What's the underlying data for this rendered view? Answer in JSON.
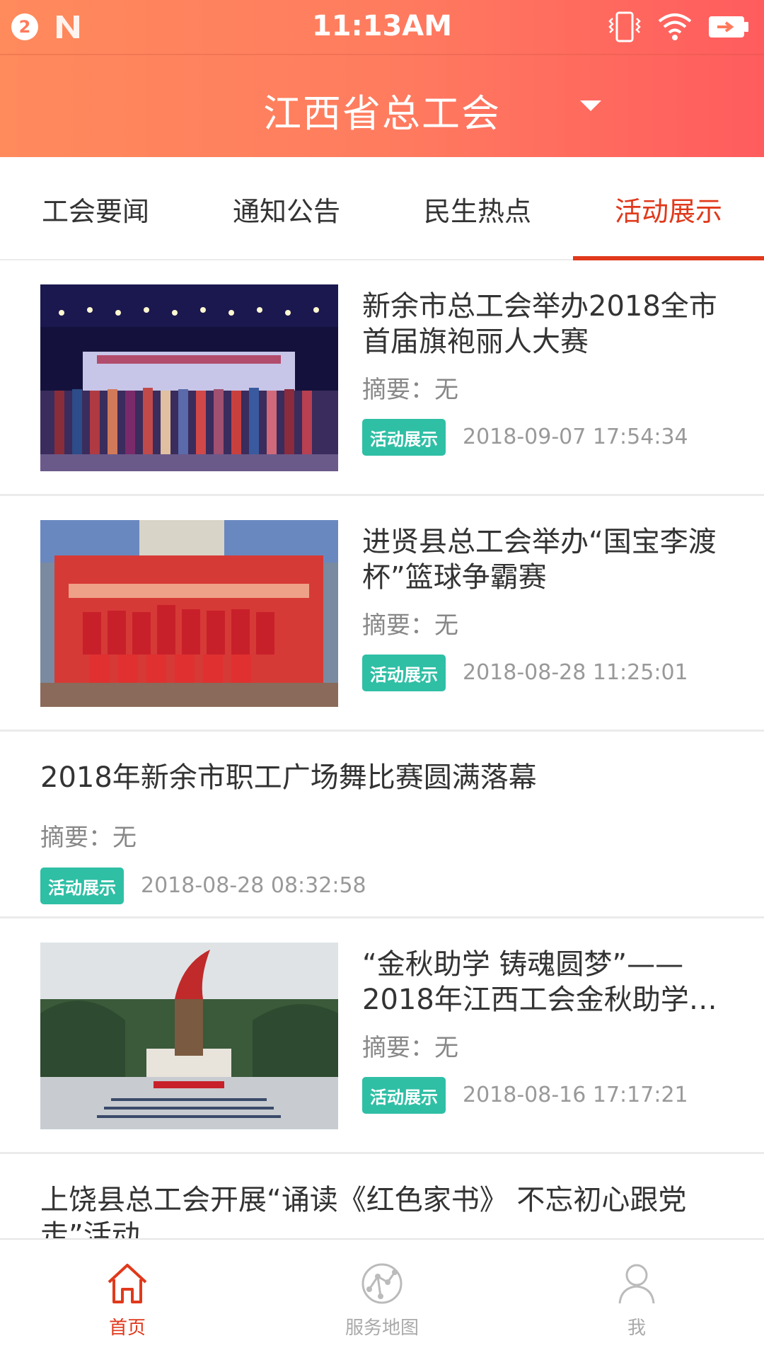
{
  "status_bar": {
    "notification_count": "2",
    "time": "11:13AM"
  },
  "header": {
    "title": "江西省总工会"
  },
  "tabs": [
    {
      "label": "工会要闻",
      "active": false
    },
    {
      "label": "通知公告",
      "active": false
    },
    {
      "label": "民生热点",
      "active": false
    },
    {
      "label": "活动展示",
      "active": true
    }
  ],
  "articles": [
    {
      "title": "新余市总工会举办2018全市首届旗袍丽人大赛",
      "summary": "摘要：无",
      "tag": "活动展示",
      "date": "2018-09-07 17:54:34",
      "has_image": true
    },
    {
      "title": "进贤县总工会举办“国宝李渡杯”篮球争霸赛",
      "summary": "摘要：无",
      "tag": "活动展示",
      "date": "2018-08-28 11:25:01",
      "has_image": true
    },
    {
      "title": "2018年新余市职工广场舞比赛圆满落幕",
      "summary": "摘要：无",
      "tag": "活动展示",
      "date": "2018-08-28 08:32:58",
      "has_image": false
    },
    {
      "title": "“金秋助学 铸魂圆梦”——2018年江西工会金秋助学…",
      "summary": "摘要：无",
      "tag": "活动展示",
      "date": "2018-08-16 17:17:21",
      "has_image": true
    },
    {
      "title": "上饶县总工会开展“诵读《红色家书》 不忘初心跟党走”活动",
      "has_image": false
    }
  ],
  "bottom_nav": [
    {
      "label": "首页",
      "icon": "home-icon",
      "active": true
    },
    {
      "label": "服务地图",
      "icon": "globe-icon",
      "active": false
    },
    {
      "label": "我",
      "icon": "user-icon",
      "active": false
    }
  ],
  "colors": {
    "accent": "#e0391b",
    "tag": "#2fbfa5",
    "header_gradient_start": "#ff8a5c",
    "header_gradient_end": "#ff5c5e"
  }
}
